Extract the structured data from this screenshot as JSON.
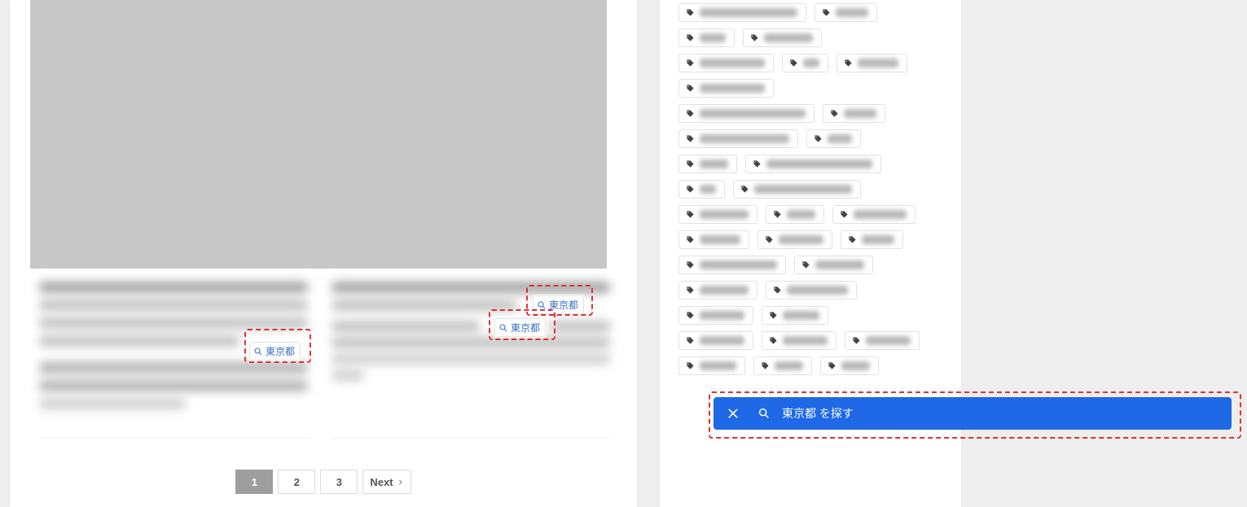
{
  "tokyo_label": "東京都",
  "search_bar_label": "東京都 を探す",
  "pagination": {
    "p1": "1",
    "p2": "2",
    "p3": "3",
    "next": "Next"
  },
  "tag_rows": [
    [
      120,
      40
    ],
    [
      32,
      60
    ],
    [
      80,
      20,
      50
    ],
    [
      80
    ],
    [
      130,
      40
    ],
    [
      110,
      30
    ],
    [
      35,
      130
    ],
    [
      20,
      120
    ],
    [
      60,
      35,
      65
    ],
    [
      50,
      55,
      40
    ],
    [
      95,
      60
    ],
    [
      60,
      75
    ],
    [
      55,
      45
    ],
    [
      55,
      55,
      55
    ],
    [
      45,
      35,
      35
    ]
  ]
}
